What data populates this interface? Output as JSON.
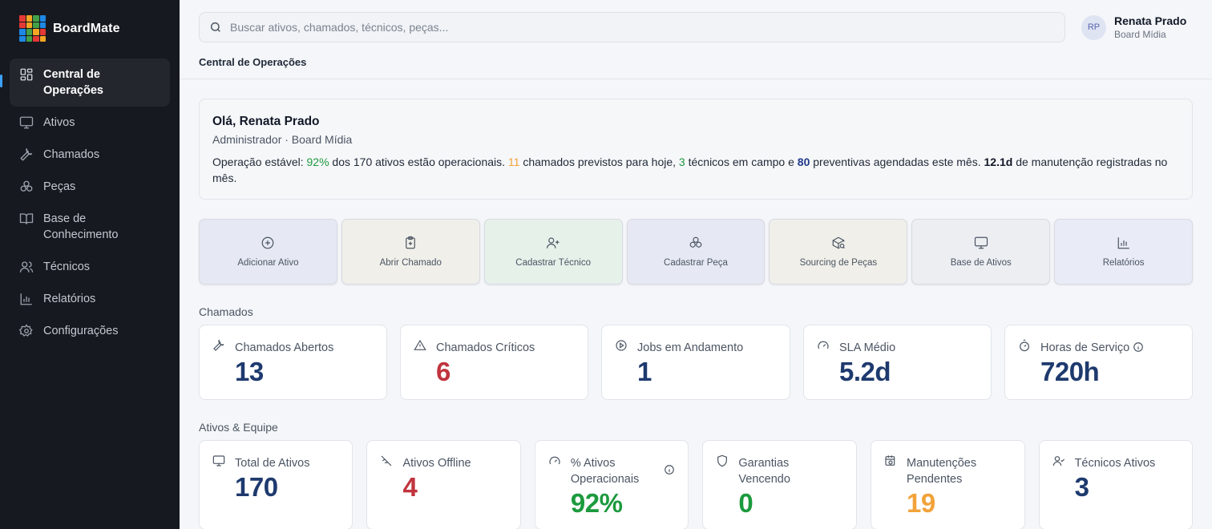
{
  "brand": {
    "name": "BoardMate",
    "logo_colors": [
      "#e53935",
      "#f4a623",
      "#43a047",
      "#1e88e5",
      "#e53935",
      "#f4a623",
      "#43a047",
      "#1e88e5",
      "#1e88e5",
      "#43a047",
      "#f4a623",
      "#e53935",
      "#1e88e5",
      "#43a047",
      "#e53935",
      "#f4a623"
    ]
  },
  "sidebar": {
    "items": [
      {
        "label": "Central de Operações",
        "icon": "dashboard-icon",
        "active": true
      },
      {
        "label": "Ativos",
        "icon": "monitor-icon"
      },
      {
        "label": "Chamados",
        "icon": "wrench-icon"
      },
      {
        "label": "Peças",
        "icon": "boxes-icon"
      },
      {
        "label": "Base de Conhecimento",
        "icon": "book-icon"
      },
      {
        "label": "Técnicos",
        "icon": "users-icon"
      },
      {
        "label": "Relatórios",
        "icon": "bar-chart-icon"
      },
      {
        "label": "Configurações",
        "icon": "gear-icon"
      }
    ]
  },
  "search": {
    "placeholder": "Buscar ativos, chamados, técnicos, peças..."
  },
  "user": {
    "initials": "RP",
    "name": "Renata Prado",
    "org": "Board Mídia"
  },
  "breadcrumb": "Central de Operações",
  "welcome": {
    "greeting": "Olá, Renata Prado",
    "role": "Administrador · Board Mídia",
    "summary": {
      "t1": "Operação estável: ",
      "pct_operational": "92%",
      "t2": " dos 170 ativos estão operacionais. ",
      "calls_today": "11",
      "t3": " chamados previstos para hoje, ",
      "techs_field": "3",
      "t4": " técnicos em campo e ",
      "preventives": "80",
      "t5": " preventivas agendadas este mês. ",
      "maintenance": "12.1d",
      "t6": " de manutenção registradas no mês."
    }
  },
  "actions": [
    {
      "label": "Adicionar Ativo",
      "icon": "plus-circle-icon",
      "bg": "#e6e9f3"
    },
    {
      "label": "Abrir Chamado",
      "icon": "clipboard-plus-icon",
      "bg": "#f0efe9"
    },
    {
      "label": "Cadastrar Técnico",
      "icon": "user-plus-icon",
      "bg": "#e6f1ea"
    },
    {
      "label": "Cadastrar Peça",
      "icon": "boxes-icon",
      "bg": "#e6e9f3"
    },
    {
      "label": "Sourcing de Peças",
      "icon": "package-search-icon",
      "bg": "#f0efe9"
    },
    {
      "label": "Base de Ativos",
      "icon": "monitor-icon",
      "bg": "#eceef2"
    },
    {
      "label": "Relatórios",
      "icon": "bar-chart-icon",
      "bg": "#e9ebf6"
    }
  ],
  "sections": {
    "chamados": "Chamados",
    "ativos_equipe": "Ativos & Equipe"
  },
  "chamados_metrics": [
    {
      "label": "Chamados Abertos",
      "value": "13",
      "icon": "wrench-icon",
      "color": "#1e3a6e"
    },
    {
      "label": "Chamados Críticos",
      "value": "6",
      "icon": "alert-triangle-icon",
      "color": "#c0343e"
    },
    {
      "label": "Jobs em Andamento",
      "value": "1",
      "icon": "play-circle-icon",
      "color": "#1e3a6e"
    },
    {
      "label": "SLA Médio",
      "value": "5.2d",
      "icon": "gauge-icon",
      "color": "#1e3a6e"
    },
    {
      "label": "Horas de Serviço",
      "value": "720h",
      "icon": "timer-icon",
      "color": "#1e3a6e"
    }
  ],
  "ativos_metrics": [
    {
      "label": "Total de Ativos",
      "value": "170",
      "icon": "monitor-icon",
      "color": "#1e3a6e"
    },
    {
      "label": "Ativos Offline",
      "value": "4",
      "icon": "wifi-off-icon",
      "color": "#c0343e"
    },
    {
      "label": "% Ativos Operacionais",
      "value": "92%",
      "icon": "gauge-icon",
      "color": "#1c9a3e"
    },
    {
      "label": "Garantias Vencendo",
      "value": "0",
      "icon": "shield-icon",
      "color": "#1c9a3e"
    },
    {
      "label": "Manutenções Pendentes",
      "value": "19",
      "icon": "calendar-clock-icon",
      "color": "#f2a23a"
    },
    {
      "label": "Técnicos Ativos",
      "value": "3",
      "icon": "user-check-icon",
      "color": "#1e3a6e"
    }
  ]
}
